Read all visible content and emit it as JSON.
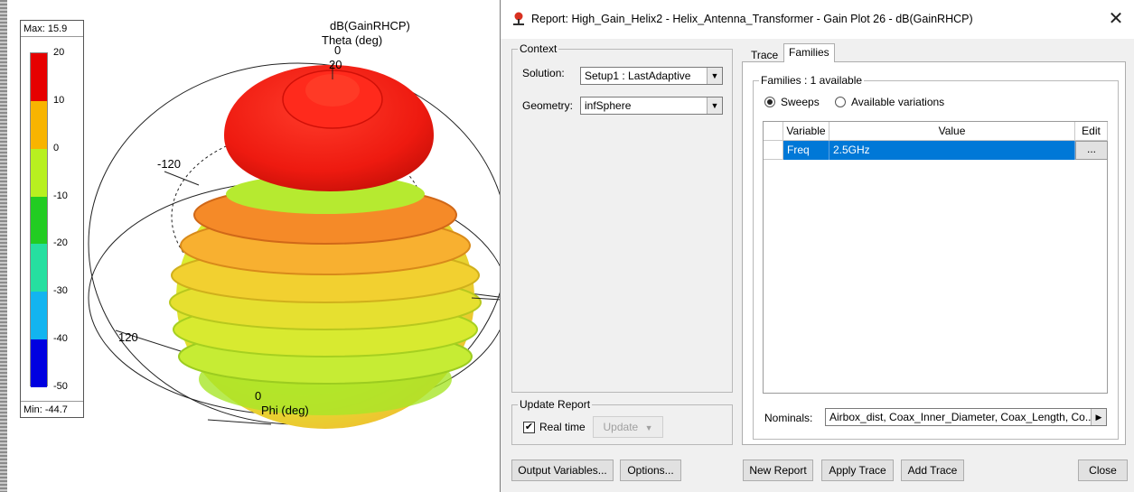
{
  "plot": {
    "title": "dB(GainRHCP)",
    "axis_theta_label": "Theta (deg)",
    "axis_phi_label": "Phi (deg)",
    "tick_theta_zero_top": "0",
    "tick_20": "20",
    "tick_neg120": "-120",
    "tick_120": "120",
    "tick_phi_zero": "0"
  },
  "legend": {
    "max_label": "Max: 15.9",
    "min_label": "Min: -44.7",
    "ticks": [
      "20",
      "10",
      "0",
      "-10",
      "-20",
      "-30",
      "-40",
      "-50"
    ],
    "colors": [
      "#e60000",
      "#f8b400",
      "#b8f020",
      "#22cc22",
      "#26dfa0",
      "#12b4f0",
      "#0000e0"
    ]
  },
  "dialog": {
    "title": "Report: High_Gain_Helix2 - Helix_Antenna_Transformer - Gain Plot 26 - dB(GainRHCP)",
    "close_icon": "close-icon",
    "context": {
      "group_label": "Context",
      "solution_label": "Solution:",
      "solution_value": "Setup1 : LastAdaptive",
      "geometry_label": "Geometry:",
      "geometry_value": "infSphere"
    },
    "update_report": {
      "group_label": "Update Report",
      "realtime_label": "Real time",
      "realtime_checked": true,
      "update_button": "Update"
    },
    "tabs": [
      "Trace",
      "Families"
    ],
    "active_tab": "Families",
    "families": {
      "group_label": "Families : 1 available",
      "radio_sweeps": "Sweeps",
      "radio_variations": "Available variations",
      "selected_radio": "Sweeps",
      "columns": [
        "Variable",
        "Value",
        "Edit"
      ],
      "rows": [
        {
          "variable": "Freq",
          "value": "2.5GHz",
          "edit": "..."
        }
      ],
      "nominals_label": "Nominals:",
      "nominals_value": "Airbox_dist, Coax_Inner_Diameter, Coax_Length, Co..."
    },
    "buttons": {
      "output_variables": "Output Variables...",
      "options": "Options...",
      "new_report": "New Report",
      "apply_trace": "Apply Trace",
      "add_trace": "Add Trace",
      "close": "Close"
    }
  }
}
